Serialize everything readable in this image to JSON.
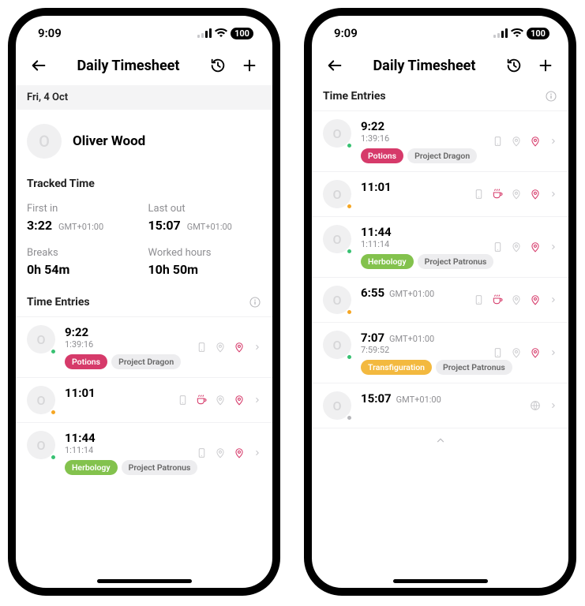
{
  "status_time": "9:09",
  "battery": "100",
  "nav_title": "Daily Timesheet",
  "user": {
    "initial": "O",
    "name": "Oliver Wood"
  },
  "date_banner": "Fri, 4 Oct",
  "sections": {
    "tracked_time": "Tracked Time",
    "time_entries": "Time Entries"
  },
  "tracked": {
    "first_in": {
      "label": "First in",
      "value": "3:22",
      "tz": "GMT+01:00"
    },
    "last_out": {
      "label": "Last out",
      "value": "15:07",
      "tz": "GMT+01:00"
    },
    "breaks": {
      "label": "Breaks",
      "value": "0h 54m"
    },
    "worked": {
      "label": "Worked hours",
      "value": "10h 50m"
    }
  },
  "entries_left": [
    {
      "initial": "O",
      "dot": "green",
      "time": "9:22",
      "tz": "",
      "duration": "1:39:16",
      "chips": [
        {
          "text": "Potions",
          "cls": "pink"
        },
        {
          "text": "Project Dragon",
          "cls": "gray"
        }
      ],
      "icons": [
        "device",
        "pin-off",
        "pin-on"
      ]
    },
    {
      "initial": "O",
      "dot": "orange",
      "time": "11:01",
      "tz": "",
      "duration": "",
      "chips": [],
      "icons": [
        "device",
        "cup",
        "pin-off",
        "pin-on"
      ]
    },
    {
      "initial": "O",
      "dot": "green",
      "time": "11:44",
      "tz": "",
      "duration": "1:11:14",
      "chips": [
        {
          "text": "Herbology",
          "cls": "green"
        },
        {
          "text": "Project Patronus",
          "cls": "gray"
        }
      ],
      "icons": [
        "device",
        "pin-off",
        "pin-on"
      ]
    }
  ],
  "entries_right": [
    {
      "initial": "O",
      "dot": "green",
      "time": "9:22",
      "tz": "",
      "duration": "1:39:16",
      "chips": [
        {
          "text": "Potions",
          "cls": "pink"
        },
        {
          "text": "Project Dragon",
          "cls": "gray"
        }
      ],
      "icons": [
        "device",
        "pin-off",
        "pin-on"
      ]
    },
    {
      "initial": "O",
      "dot": "orange",
      "time": "11:01",
      "tz": "",
      "duration": "",
      "chips": [],
      "icons": [
        "device",
        "cup",
        "pin-off",
        "pin-on"
      ]
    },
    {
      "initial": "O",
      "dot": "green",
      "time": "11:44",
      "tz": "",
      "duration": "1:11:14",
      "chips": [
        {
          "text": "Herbology",
          "cls": "green"
        },
        {
          "text": "Project Patronus",
          "cls": "gray"
        }
      ],
      "icons": [
        "device",
        "pin-off",
        "pin-on"
      ]
    },
    {
      "initial": "O",
      "dot": "orange",
      "time": "6:55",
      "tz": "GMT+01:00",
      "duration": "",
      "chips": [],
      "icons": [
        "device",
        "cup",
        "pin-off",
        "pin-on"
      ]
    },
    {
      "initial": "O",
      "dot": "green",
      "time": "7:07",
      "tz": "GMT+01:00",
      "duration": "7:59:52",
      "chips": [
        {
          "text": "Transfiguration",
          "cls": "yellow"
        },
        {
          "text": "Project Patronus",
          "cls": "gray"
        }
      ],
      "icons": [
        "device",
        "pin-off",
        "pin-on"
      ]
    },
    {
      "initial": "O",
      "dot": "gray",
      "time": "15:07",
      "tz": "GMT+01:00",
      "duration": "",
      "chips": [],
      "icons": [
        "globe"
      ]
    }
  ]
}
